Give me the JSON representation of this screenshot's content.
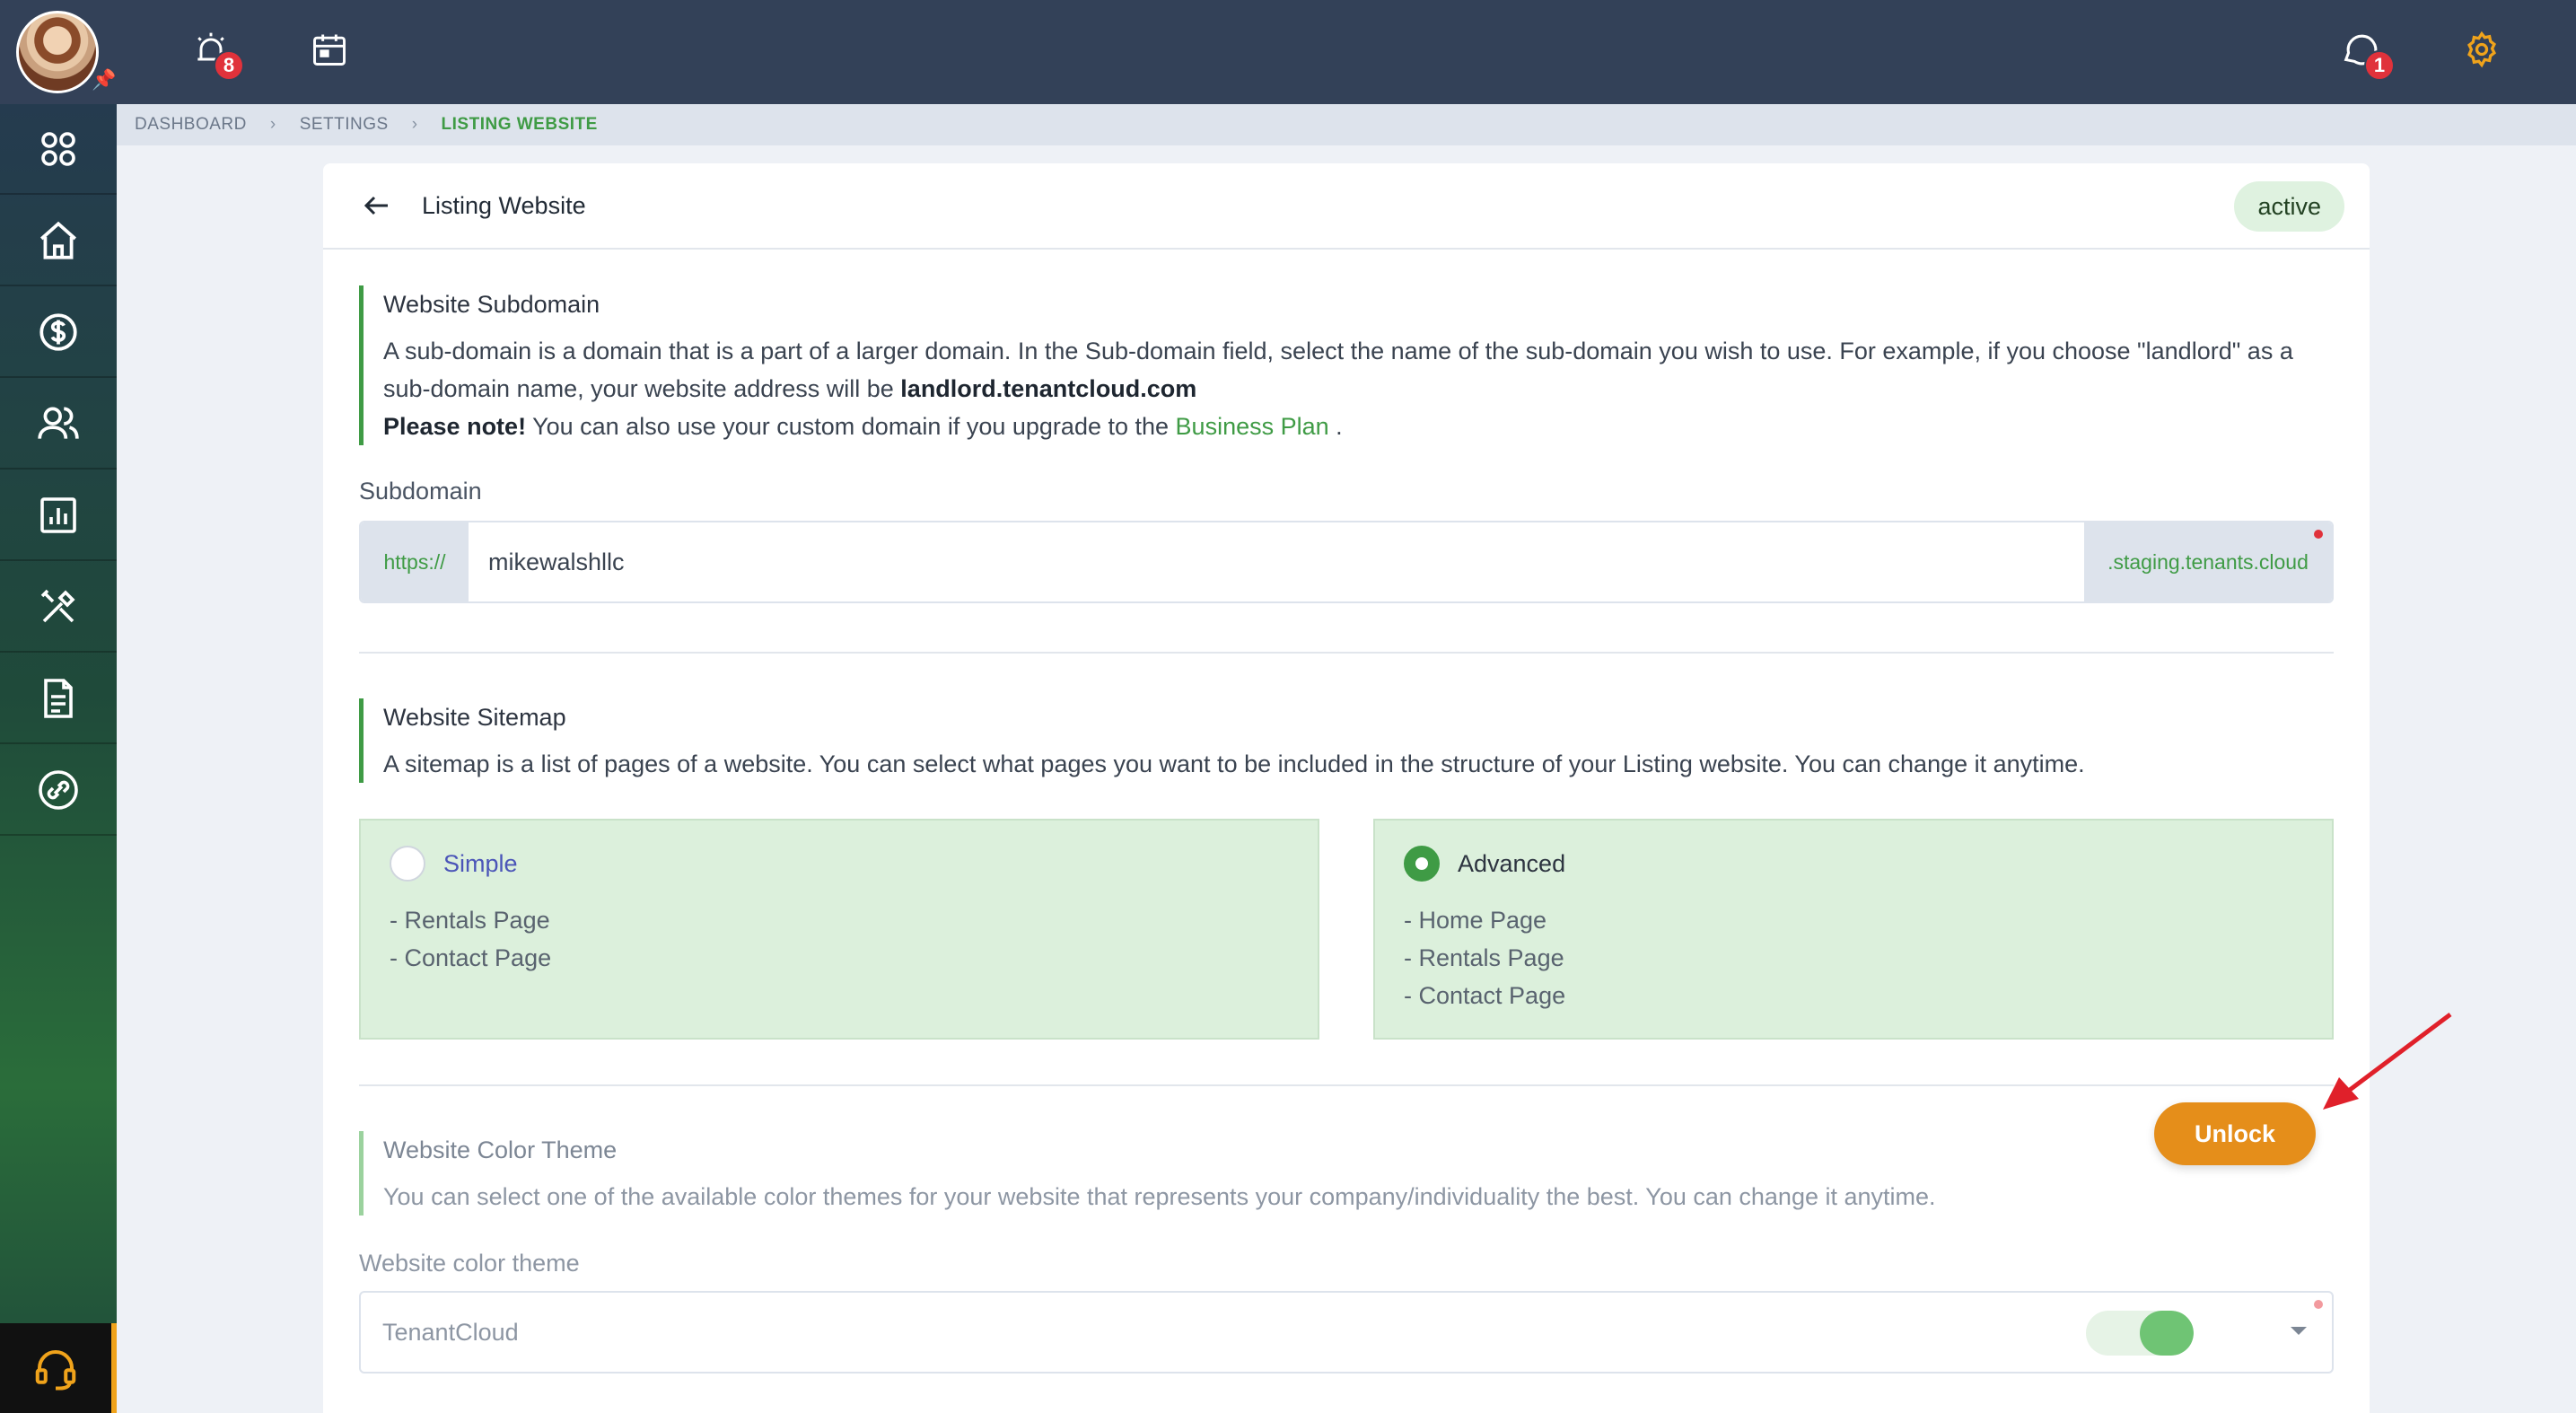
{
  "topbar": {
    "alerts_badge": "8",
    "messages_badge": "1"
  },
  "sidebar": {
    "items": [
      "apps-grid-icon",
      "home-icon",
      "dollar-icon",
      "users-icon",
      "reports-icon",
      "tools-icon",
      "document-icon",
      "link-icon"
    ],
    "support": "headset-icon"
  },
  "breadcrumb": {
    "dashboard": "DASHBOARD",
    "settings": "SETTINGS",
    "current": "LISTING WEBSITE"
  },
  "card": {
    "title": "Listing Website",
    "status": "active"
  },
  "subdomain_section": {
    "heading": "Website Subdomain",
    "text_1": "A sub-domain is a domain that is a part of a larger domain. In the Sub-domain field, select the name of the sub-domain you wish to use. For example, if you choose \"landlord\" as a sub-domain name, your website address will be",
    "example_domain": "landlord.tenantcloud.com",
    "note_label": "Please note!",
    "note_text": "You can also use your custom domain if you upgrade to the",
    "note_link": "Business Plan",
    "note_end": ".",
    "field_label": "Subdomain",
    "prefix": "https://",
    "value": "mikewalshllc",
    "suffix": ".staging.tenants.cloud"
  },
  "sitemap_section": {
    "heading": "Website Sitemap",
    "text": "A sitemap is a list of pages of a website. You can select what pages you want to be included in the structure of your Listing website. You can change it anytime.",
    "options": [
      {
        "label": "Simple",
        "selected": false,
        "pages": [
          "- Rentals Page",
          "- Contact Page"
        ]
      },
      {
        "label": "Advanced",
        "selected": true,
        "pages": [
          "- Home Page",
          "- Rentals Page",
          "- Contact Page"
        ]
      }
    ]
  },
  "theme_section": {
    "heading": "Website Color Theme",
    "text": "You can select one of the available color themes for your website that represents your company/individuality the best. You can change it anytime.",
    "unlock_label": "Unlock",
    "field_label": "Website color theme",
    "selected_theme": "TenantCloud"
  },
  "colors": {
    "accent_green": "#3f9b45",
    "unlock_orange": "#e58e1a",
    "topbar": "#334158",
    "annotation_arrow": "#e0202a"
  }
}
